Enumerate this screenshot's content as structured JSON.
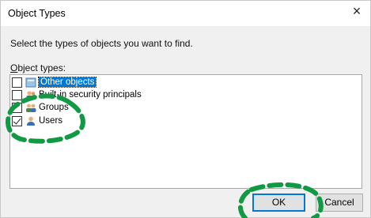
{
  "dialog": {
    "title": "Object Types",
    "close_glyph": "×",
    "instruction": "Select the types of objects you want to find.",
    "list_label_accesskey": "O",
    "list_label_rest": "bject types:",
    "items": [
      {
        "label": "Other objects",
        "checked": false,
        "selected": true,
        "icon": "other-objects-icon"
      },
      {
        "label": "Built-in security principals",
        "checked": false,
        "selected": false,
        "icon": "security-principals-icon"
      },
      {
        "label": "Groups",
        "checked": false,
        "selected": false,
        "icon": "groups-icon"
      },
      {
        "label": "Users",
        "checked": true,
        "selected": false,
        "icon": "users-icon"
      }
    ],
    "ok_label": "OK",
    "cancel_label": "Cancel"
  },
  "annotation": {
    "color": "#119944"
  }
}
